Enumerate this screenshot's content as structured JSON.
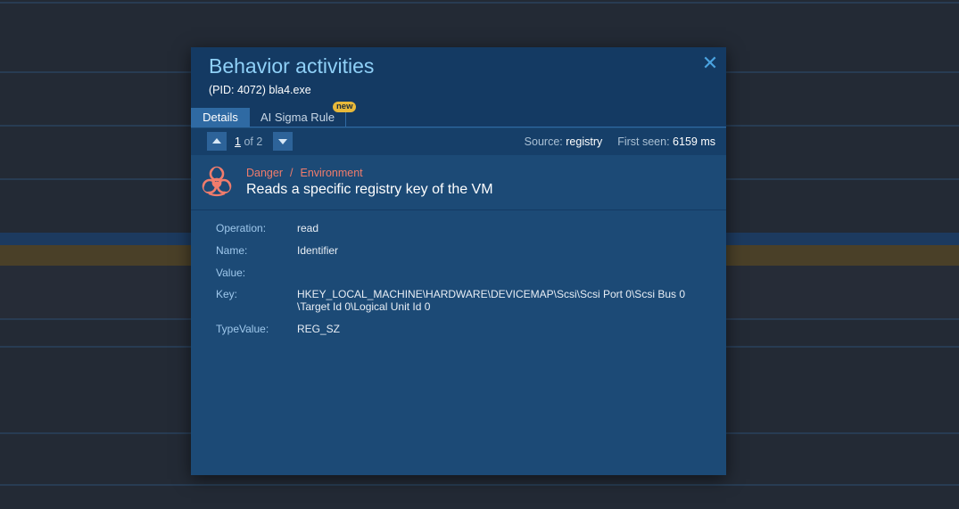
{
  "modal": {
    "title": "Behavior activities",
    "subtitle": "(PID: 4072) bla4.exe",
    "close_label": "✕"
  },
  "tabs": [
    {
      "label": "Details",
      "active": true
    },
    {
      "label": "AI Sigma Rule",
      "active": false,
      "badge": "new"
    }
  ],
  "pager": {
    "current": "1",
    "of_text": "of 2"
  },
  "meta": {
    "source_label": "Source:",
    "source_value": "registry",
    "first_seen_label": "First seen:",
    "first_seen_value": "6159 ms"
  },
  "event": {
    "severity": "Danger",
    "category": "Environment",
    "separator": "/",
    "title": "Reads a specific registry key of the VM",
    "icon": "biohazard-icon",
    "icon_color": "#f07c6c"
  },
  "details": [
    {
      "label": "Operation:",
      "value": "read"
    },
    {
      "label": "Name:",
      "value": "Identifier"
    },
    {
      "label": "Value:",
      "value": ""
    },
    {
      "label": "Key:",
      "value": "HKEY_LOCAL_MACHINE\\HARDWARE\\DEVICEMAP\\Scsi\\Scsi Port 0\\Scsi Bus 0\n\\Target Id 0\\Logical Unit Id 0"
    },
    {
      "label": "TypeValue:",
      "value": "REG_SZ"
    }
  ],
  "colors": {
    "modal_bg": "#1c4a76",
    "header_bg": "#143a63",
    "accent": "#8fd0f7",
    "danger": "#f07c6c",
    "badge": "#e8b93a"
  }
}
